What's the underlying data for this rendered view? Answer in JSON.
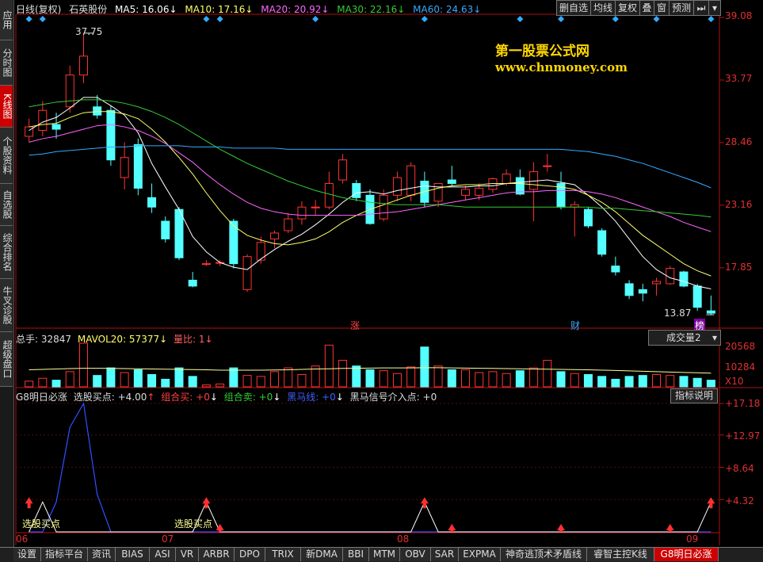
{
  "header": {
    "chart_mode": "日线(复权)",
    "stock_name": "石英股份",
    "ma5": "MA5: 16.06",
    "ma10": "MA10: 17.16",
    "ma20": "MA20: 20.92",
    "ma30": "MA30: 22.16",
    "ma60": "MA60: 24.63",
    "colors": {
      "ma5": "#ffffff",
      "ma10": "#ffff66",
      "ma20": "#ff66ff",
      "ma30": "#33cc33",
      "ma60": "#33aaff"
    }
  },
  "toolbar": {
    "delete_label": "删自选",
    "average_label": "均线",
    "adjust_label": "复权",
    "overlay_label": "叠",
    "window_label": "窗",
    "forecast_label": "预测"
  },
  "side_tabs": [
    {
      "label": "应用",
      "active": false
    },
    {
      "label": "分时图",
      "active": false
    },
    {
      "label": "K线图",
      "active": true
    },
    {
      "label": "个股资料",
      "active": false
    },
    {
      "label": "自选股",
      "active": false
    },
    {
      "label": "综合排名",
      "active": false
    },
    {
      "label": "牛叉诊股",
      "active": false
    },
    {
      "label": "超级盘口",
      "active": false
    }
  ],
  "watermark": {
    "title": "第一股票公式网",
    "url": "www.chnmoney.com"
  },
  "price_axis": [
    "39.08",
    "33.77",
    "28.46",
    "23.16",
    "17.85"
  ],
  "annotations": {
    "high": "37.75",
    "low": "13.87",
    "zhang": "涨",
    "cai": "财",
    "bang": "榜"
  },
  "volume_panel": {
    "total": "总手: 32847",
    "mavol": "MAVOL20: 57377",
    "ratio": "量比: 1",
    "selector": "成交量2",
    "axis": [
      "20568",
      "10284",
      "X10"
    ]
  },
  "indicator_panel": {
    "name": "G8明日必涨",
    "buy_point": "选股买点: +4.00",
    "combo_buy": "组合买: +0",
    "combo_sell": "组合卖: +0",
    "dark_horse": "黑马线: +0",
    "dark_signal": "黑马信号介入点: +0",
    "help_button": "指标说明",
    "axis": [
      "+17.18",
      "+12.97",
      "+8.64",
      "+4.32"
    ],
    "signal_label": "选股买点"
  },
  "x_axis": [
    "06",
    "07",
    "08",
    "09"
  ],
  "bottom_tabs": [
    {
      "label": "设置",
      "active": false
    },
    {
      "label": "指标平台",
      "active": false
    },
    {
      "label": "资讯",
      "active": false
    },
    {
      "label": "BIAS",
      "active": false
    },
    {
      "label": "ASI",
      "active": false
    },
    {
      "label": "VR",
      "active": false
    },
    {
      "label": "ARBR",
      "active": false
    },
    {
      "label": "DPO",
      "active": false
    },
    {
      "label": "TRIX",
      "active": false
    },
    {
      "label": "新DMA",
      "active": false
    },
    {
      "label": "BBI",
      "active": false
    },
    {
      "label": "MTM",
      "active": false
    },
    {
      "label": "OBV",
      "active": false
    },
    {
      "label": "SAR",
      "active": false
    },
    {
      "label": "EXPMA",
      "active": false
    },
    {
      "label": "神奇逃顶术矛盾线",
      "active": false
    },
    {
      "label": "睿智主控K线",
      "active": false
    },
    {
      "label": "G8明日必涨",
      "active": true
    }
  ],
  "chart_data": {
    "type": "candlestick",
    "price_range": [
      13.0,
      39.08
    ],
    "candles": [
      {
        "o": 29.0,
        "h": 30.5,
        "l": 28.5,
        "c": 29.8
      },
      {
        "o": 29.5,
        "h": 32.0,
        "l": 29.0,
        "c": 31.2
      },
      {
        "o": 30.0,
        "h": 31.0,
        "l": 28.8,
        "c": 29.6
      },
      {
        "o": 31.5,
        "h": 35.0,
        "l": 31.0,
        "c": 34.2
      },
      {
        "o": 34.2,
        "h": 37.75,
        "l": 33.5,
        "c": 35.8
      },
      {
        "o": 31.5,
        "h": 32.5,
        "l": 30.5,
        "c": 30.8
      },
      {
        "o": 31.2,
        "h": 31.6,
        "l": 26.5,
        "c": 27.0
      },
      {
        "o": 25.5,
        "h": 28.5,
        "l": 24.5,
        "c": 27.2
      },
      {
        "o": 28.3,
        "h": 28.8,
        "l": 24.0,
        "c": 24.6
      },
      {
        "o": 23.8,
        "h": 25.0,
        "l": 22.5,
        "c": 23.0
      },
      {
        "o": 21.8,
        "h": 22.2,
        "l": 20.0,
        "c": 20.3
      },
      {
        "o": 22.8,
        "h": 23.0,
        "l": 18.5,
        "c": 18.7
      },
      {
        "o": 16.8,
        "h": 17.5,
        "l": 16.2,
        "c": 16.3
      },
      {
        "o": 18.2,
        "h": 18.5,
        "l": 18.0,
        "c": 18.2
      },
      {
        "o": 18.3,
        "h": 18.5,
        "l": 18.0,
        "c": 18.3
      },
      {
        "o": 21.8,
        "h": 22.0,
        "l": 17.8,
        "c": 18.2
      },
      {
        "o": 16.0,
        "h": 19.0,
        "l": 15.8,
        "c": 18.8
      },
      {
        "o": 18.5,
        "h": 20.5,
        "l": 18.2,
        "c": 20.0
      },
      {
        "o": 20.3,
        "h": 21.0,
        "l": 19.5,
        "c": 20.8
      },
      {
        "o": 21.0,
        "h": 22.5,
        "l": 20.8,
        "c": 22.0
      },
      {
        "o": 22.0,
        "h": 23.5,
        "l": 21.5,
        "c": 23.0
      },
      {
        "o": 23.0,
        "h": 23.6,
        "l": 22.3,
        "c": 23.0
      },
      {
        "o": 23.0,
        "h": 26.0,
        "l": 22.8,
        "c": 25.0
      },
      {
        "o": 25.3,
        "h": 27.5,
        "l": 25.0,
        "c": 27.0
      },
      {
        "o": 25.0,
        "h": 25.3,
        "l": 23.5,
        "c": 23.8
      },
      {
        "o": 24.0,
        "h": 24.5,
        "l": 21.5,
        "c": 21.6
      },
      {
        "o": 22.0,
        "h": 24.5,
        "l": 21.8,
        "c": 24.0
      },
      {
        "o": 24.0,
        "h": 26.0,
        "l": 23.5,
        "c": 25.5
      },
      {
        "o": 24.0,
        "h": 26.8,
        "l": 23.5,
        "c": 26.5
      },
      {
        "o": 25.2,
        "h": 26.0,
        "l": 23.0,
        "c": 23.4
      },
      {
        "o": 23.5,
        "h": 25.0,
        "l": 23.0,
        "c": 25.0
      },
      {
        "o": 25.3,
        "h": 26.5,
        "l": 24.8,
        "c": 25.0
      },
      {
        "o": 24.0,
        "h": 24.8,
        "l": 23.6,
        "c": 24.5
      },
      {
        "o": 24.0,
        "h": 25.0,
        "l": 23.6,
        "c": 24.6
      },
      {
        "o": 24.5,
        "h": 25.5,
        "l": 24.2,
        "c": 25.4
      },
      {
        "o": 25.0,
        "h": 26.2,
        "l": 24.8,
        "c": 25.8
      },
      {
        "o": 25.5,
        "h": 26.2,
        "l": 24.0,
        "c": 24.1
      },
      {
        "o": 24.5,
        "h": 26.8,
        "l": 21.8,
        "c": 26.0
      },
      {
        "o": 26.5,
        "h": 27.5,
        "l": 26.0,
        "c": 26.5
      },
      {
        "o": 25.0,
        "h": 26.0,
        "l": 22.8,
        "c": 23.0
      },
      {
        "o": 23.0,
        "h": 23.5,
        "l": 20.5,
        "c": 23.2
      },
      {
        "o": 22.8,
        "h": 23.0,
        "l": 21.2,
        "c": 21.4
      },
      {
        "o": 21.0,
        "h": 21.2,
        "l": 18.8,
        "c": 19.0
      },
      {
        "o": 18.0,
        "h": 18.8,
        "l": 17.2,
        "c": 17.5
      },
      {
        "o": 16.5,
        "h": 16.8,
        "l": 15.2,
        "c": 15.5
      },
      {
        "o": 16.0,
        "h": 16.5,
        "l": 15.0,
        "c": 15.7
      },
      {
        "o": 16.5,
        "h": 17.0,
        "l": 15.5,
        "c": 16.7
      },
      {
        "o": 16.5,
        "h": 18.0,
        "l": 16.4,
        "c": 17.8
      },
      {
        "o": 17.5,
        "h": 17.6,
        "l": 16.2,
        "c": 16.3
      },
      {
        "o": 16.3,
        "h": 16.5,
        "l": 14.2,
        "c": 14.5
      },
      {
        "o": 14.2,
        "h": 15.5,
        "l": 13.87,
        "c": 14.0
      }
    ],
    "ma5": [
      29.5,
      30.2,
      30.6,
      31.4,
      32.3,
      32.3,
      31.6,
      30.8,
      29.3,
      26.7,
      24.7,
      22.8,
      20.5,
      19.2,
      18.3,
      17.9,
      17.7,
      18.6,
      19.4,
      20.1,
      20.7,
      21.5,
      22.4,
      23.4,
      24.2,
      24.3,
      24.1,
      24.4,
      24.6,
      24.8,
      24.7,
      24.7,
      24.7,
      24.8,
      24.8,
      25.0,
      25.1,
      25.2,
      25.3,
      25.1,
      24.9,
      24.0,
      23.0,
      21.8,
      20.3,
      18.8,
      17.7,
      17.0,
      16.7,
      16.3,
      16.06
    ],
    "ma10": [
      29.8,
      30.0,
      30.1,
      30.6,
      31.0,
      31.1,
      31.1,
      30.9,
      30.5,
      29.6,
      28.5,
      27.2,
      25.8,
      24.2,
      22.7,
      21.4,
      20.6,
      20.2,
      19.9,
      19.8,
      20.0,
      20.3,
      20.9,
      21.7,
      22.3,
      22.8,
      23.2,
      23.6,
      24.0,
      24.3,
      24.6,
      24.8,
      24.9,
      24.9,
      25.0,
      25.0,
      25.0,
      24.9,
      24.8,
      24.7,
      24.5,
      24.0,
      23.4,
      22.6,
      21.6,
      20.6,
      19.8,
      19.0,
      18.2,
      17.6,
      17.16
    ],
    "ma20": [
      28.5,
      28.8,
      29.0,
      29.3,
      29.6,
      29.9,
      30.0,
      29.8,
      29.5,
      29.0,
      28.4,
      27.6,
      26.8,
      25.8,
      24.9,
      24.1,
      23.4,
      22.9,
      22.6,
      22.4,
      22.3,
      22.3,
      22.3,
      22.3,
      22.3,
      22.4,
      22.5,
      22.6,
      22.8,
      23.0,
      23.2,
      23.4,
      23.6,
      23.8,
      24.0,
      24.2,
      24.3,
      24.3,
      24.4,
      24.4,
      24.4,
      24.3,
      24.1,
      23.8,
      23.4,
      23.0,
      22.6,
      22.2,
      21.7,
      21.3,
      20.92
    ],
    "ma30": [
      31.5,
      31.7,
      31.9,
      32.0,
      32.1,
      32.1,
      32.0,
      31.8,
      31.5,
      31.1,
      30.6,
      30.0,
      29.3,
      28.6,
      27.9,
      27.3,
      26.7,
      26.2,
      25.7,
      25.2,
      24.8,
      24.4,
      24.1,
      23.8,
      23.6,
      23.4,
      23.3,
      23.2,
      23.2,
      23.2,
      23.2,
      23.1,
      23.0,
      23.0,
      23.0,
      23.0,
      23.0,
      23.0,
      23.0,
      23.0,
      23.0,
      23.0,
      22.9,
      22.9,
      22.8,
      22.7,
      22.6,
      22.5,
      22.4,
      22.3,
      22.16
    ],
    "ma60": [
      27.4,
      27.5,
      27.7,
      27.8,
      27.9,
      28.0,
      28.1,
      28.1,
      28.2,
      28.2,
      28.2,
      28.2,
      28.1,
      28.1,
      28.1,
      28.0,
      28.0,
      28.0,
      28.0,
      27.9,
      27.9,
      27.9,
      27.9,
      27.9,
      27.9,
      27.9,
      27.9,
      27.9,
      27.9,
      27.9,
      27.9,
      27.9,
      27.9,
      27.9,
      27.9,
      27.9,
      27.9,
      27.9,
      27.9,
      27.9,
      27.8,
      27.7,
      27.5,
      27.3,
      27.0,
      26.7,
      26.3,
      25.9,
      25.5,
      25.1,
      24.63
    ],
    "volume_range": [
      0,
      23000
    ],
    "volumes": [
      3000,
      4500,
      3500,
      8000,
      23000,
      6000,
      10000,
      7500,
      9000,
      6500,
      4000,
      10000,
      5500,
      1000,
      1500,
      10000,
      6000,
      5500,
      8000,
      10000,
      6500,
      11000,
      22000,
      14000,
      11000,
      9000,
      8500,
      7000,
      10500,
      21000,
      11000,
      9000,
      9000,
      7500,
      8000,
      7000,
      8500,
      10000,
      14000,
      8000,
      7000,
      6500,
      5500,
      4000,
      5500,
      6000,
      6500,
      6000,
      5500,
      4500,
      3500
    ],
    "mavol": [
      9000,
      9200,
      9400,
      9600,
      9800,
      9800,
      9700,
      9600,
      9500,
      9400,
      9300,
      9200,
      9100,
      9000,
      8800,
      8800,
      8800,
      8800,
      8900,
      9000,
      9200,
      9400,
      9500,
      9700,
      9800,
      9900,
      10000,
      10000,
      10000,
      10100,
      10100,
      10000,
      9900,
      9800,
      9700,
      9600,
      9500,
      9400,
      9300,
      9200,
      9100,
      9000,
      8800,
      8600,
      8400,
      8200,
      8000,
      7800,
      7600,
      7400,
      7200
    ],
    "indicator_range": [
      0,
      17.18
    ],
    "indicator_blue": [
      0,
      0,
      4.0,
      14.0,
      17.18,
      5.0,
      0,
      0,
      0,
      0,
      0,
      0,
      0,
      0,
      0,
      0,
      0,
      0,
      0,
      0,
      0,
      0,
      0,
      0,
      0,
      0,
      0,
      0,
      0,
      0,
      0,
      0,
      0,
      0,
      0,
      0,
      0,
      0,
      0,
      0,
      0,
      0,
      0,
      0,
      0,
      0,
      0,
      0,
      0,
      0,
      0
    ],
    "indicator_white": [
      0,
      4.0,
      0,
      0,
      0,
      0,
      0,
      0,
      0,
      0,
      0,
      0,
      0,
      4.0,
      0,
      0,
      0,
      0,
      0,
      0,
      0,
      0,
      0,
      0,
      0,
      0,
      0,
      0,
      0,
      4.0,
      0,
      0,
      0,
      0,
      0,
      0,
      0,
      0,
      0,
      0,
      0,
      0,
      0,
      0,
      0,
      0,
      0,
      0,
      0,
      0,
      4.0
    ],
    "up_markers": [
      0,
      13,
      29,
      50
    ],
    "small_markers": [
      14,
      31,
      39,
      47
    ]
  }
}
